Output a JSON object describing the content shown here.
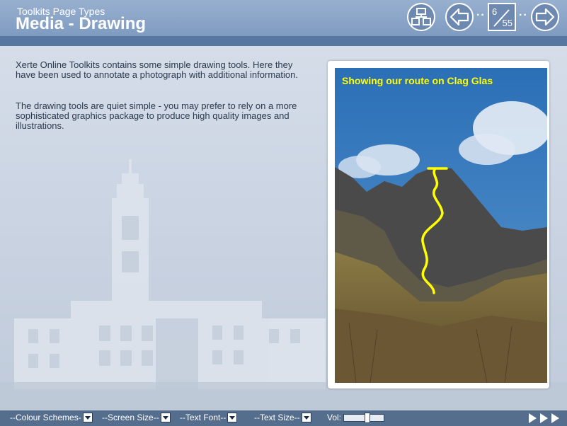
{
  "header": {
    "subtitle": "Toolkits Page Types",
    "title": "Media - Drawing",
    "page_current": "6",
    "page_total": "55",
    "dots": "··"
  },
  "content": {
    "paragraph1": "Xerte Online Toolkits contains some simple drawing tools. Here they have been used to annotate a photograph with additional information.",
    "paragraph2": "The drawing tools are quiet simple - you may prefer to rely on a more sophisticated graphics package to produce high quality images and illustrations.",
    "image_caption": "Showing our route on Clag Glas"
  },
  "footer": {
    "colour_schemes": "--Colour Schemes-",
    "screen_size": "--Screen Size--",
    "text_font": "--Text Font--",
    "text_size": "--Text Size--",
    "vol_label": "Vol:",
    "volume_level": 0.6
  },
  "icons": {
    "menu": "site-map-icon",
    "back": "arrow-left-icon",
    "next": "arrow-right-icon"
  }
}
